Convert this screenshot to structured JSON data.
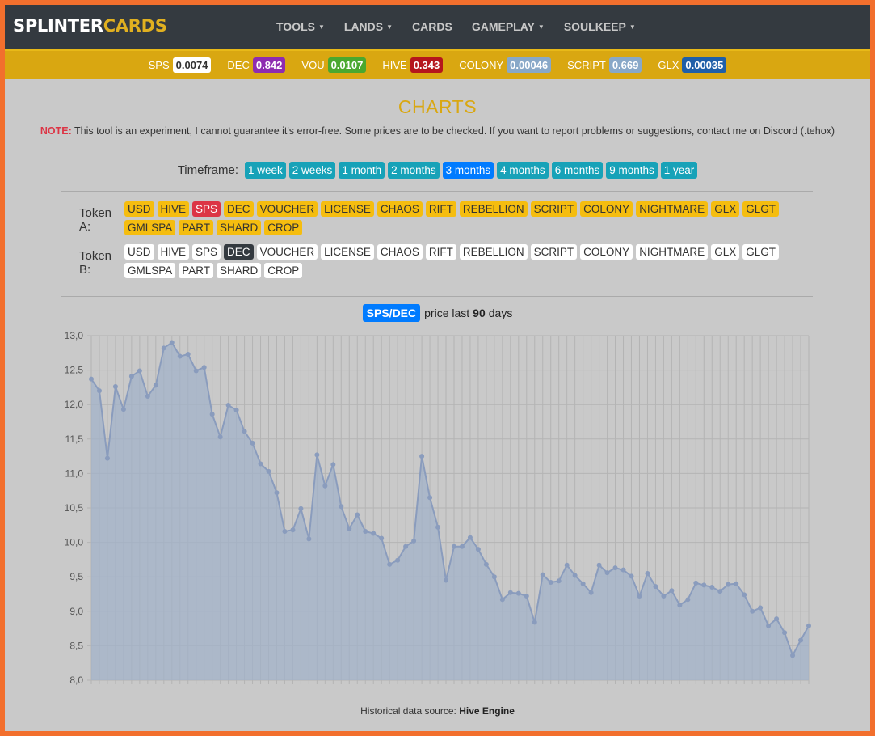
{
  "brand": {
    "part1": "SPLINTER",
    "part2": "CARDS"
  },
  "nav": [
    {
      "label": "TOOLS",
      "dropdown": true
    },
    {
      "label": "LANDS",
      "dropdown": true
    },
    {
      "label": "CARDS",
      "dropdown": false
    },
    {
      "label": "GAMEPLAY",
      "dropdown": true
    },
    {
      "label": "SOULKEEP",
      "dropdown": true
    }
  ],
  "ticker": [
    {
      "label": "SPS",
      "value": "0.0074",
      "bg": "#ffffff",
      "fg": "#333333"
    },
    {
      "label": "DEC",
      "value": "0.842",
      "bg": "#8e2cb0",
      "fg": "#ffffff"
    },
    {
      "label": "VOU",
      "value": "0.0107",
      "bg": "#4aa82e",
      "fg": "#ffffff"
    },
    {
      "label": "HIVE",
      "value": "0.343",
      "bg": "#b5161c",
      "fg": "#ffffff"
    },
    {
      "label": "COLONY",
      "value": "0.00046",
      "bg": "#88a8c8",
      "fg": "#ffffff"
    },
    {
      "label": "SCRIPT",
      "value": "0.669",
      "bg": "#88a8c8",
      "fg": "#ffffff"
    },
    {
      "label": "GLX",
      "value": "0.00035",
      "bg": "#1f5fa8",
      "fg": "#ffffff"
    }
  ],
  "page": {
    "title": "CHARTS",
    "note_label": "NOTE:",
    "note_text": " This tool is an experiment, I cannot guarantee it's error-free. Some prices are to be checked. If you want to report problems or suggestions, contact me on Discord (.tehox)"
  },
  "timeframe": {
    "label": "Timeframe:",
    "options": [
      "1 week",
      "2 weeks",
      "1 month",
      "2 months",
      "3 months",
      "4 months",
      "6 months",
      "9 months",
      "1 year"
    ],
    "selected": "3 months"
  },
  "tokenA": {
    "label": "Token A:",
    "options": [
      "USD",
      "HIVE",
      "SPS",
      "DEC",
      "VOUCHER",
      "LICENSE",
      "CHAOS",
      "RIFT",
      "REBELLION",
      "SCRIPT",
      "COLONY",
      "NIGHTMARE",
      "GLX",
      "GLGT",
      "GMLSPA",
      "PART",
      "SHARD",
      "CROP"
    ],
    "selected": "SPS"
  },
  "tokenB": {
    "label": "Token B:",
    "options": [
      "USD",
      "HIVE",
      "SPS",
      "DEC",
      "VOUCHER",
      "LICENSE",
      "CHAOS",
      "RIFT",
      "REBELLION",
      "SCRIPT",
      "COLONY",
      "NIGHTMARE",
      "GLX",
      "GLGT",
      "GMLSPA",
      "PART",
      "SHARD",
      "CROP"
    ],
    "selected": "DEC"
  },
  "chart_header": {
    "pair": "SPS/DEC",
    "mid": "price last",
    "days": "90",
    "suffix": "days"
  },
  "source": {
    "label": "Historical data source:",
    "name": "Hive Engine"
  },
  "chart_data": {
    "type": "area",
    "ylim": [
      8.0,
      13.0
    ],
    "yticks": [
      "13,0",
      "12,5",
      "12,0",
      "11,5",
      "11,0",
      "10,5",
      "10,0",
      "9,5",
      "9,0",
      "8,5",
      "8,0"
    ],
    "grid": true,
    "color": "#8a9cbd",
    "values": [
      12.37,
      12.2,
      11.22,
      12.26,
      11.93,
      12.41,
      12.49,
      12.12,
      12.28,
      12.82,
      12.9,
      12.7,
      12.73,
      12.49,
      12.54,
      11.86,
      11.53,
      11.99,
      11.92,
      11.61,
      11.44,
      11.14,
      11.03,
      10.72,
      10.16,
      10.18,
      10.49,
      10.05,
      11.27,
      10.82,
      11.13,
      10.52,
      10.2,
      10.4,
      10.16,
      10.13,
      10.06,
      9.68,
      9.74,
      9.94,
      10.02,
      11.25,
      10.65,
      10.22,
      9.45,
      9.94,
      9.94,
      10.07,
      9.9,
      9.68,
      9.5,
      9.17,
      9.27,
      9.26,
      9.22,
      8.84,
      9.53,
      9.42,
      9.44,
      9.67,
      9.52,
      9.4,
      9.27,
      9.67,
      9.56,
      9.63,
      9.6,
      9.51,
      9.22,
      9.55,
      9.36,
      9.22,
      9.3,
      9.09,
      9.17,
      9.41,
      9.38,
      9.35,
      9.29,
      9.39,
      9.4,
      9.24,
      9.0,
      9.05,
      8.79,
      8.89,
      8.69,
      8.36,
      8.58,
      8.79
    ]
  }
}
